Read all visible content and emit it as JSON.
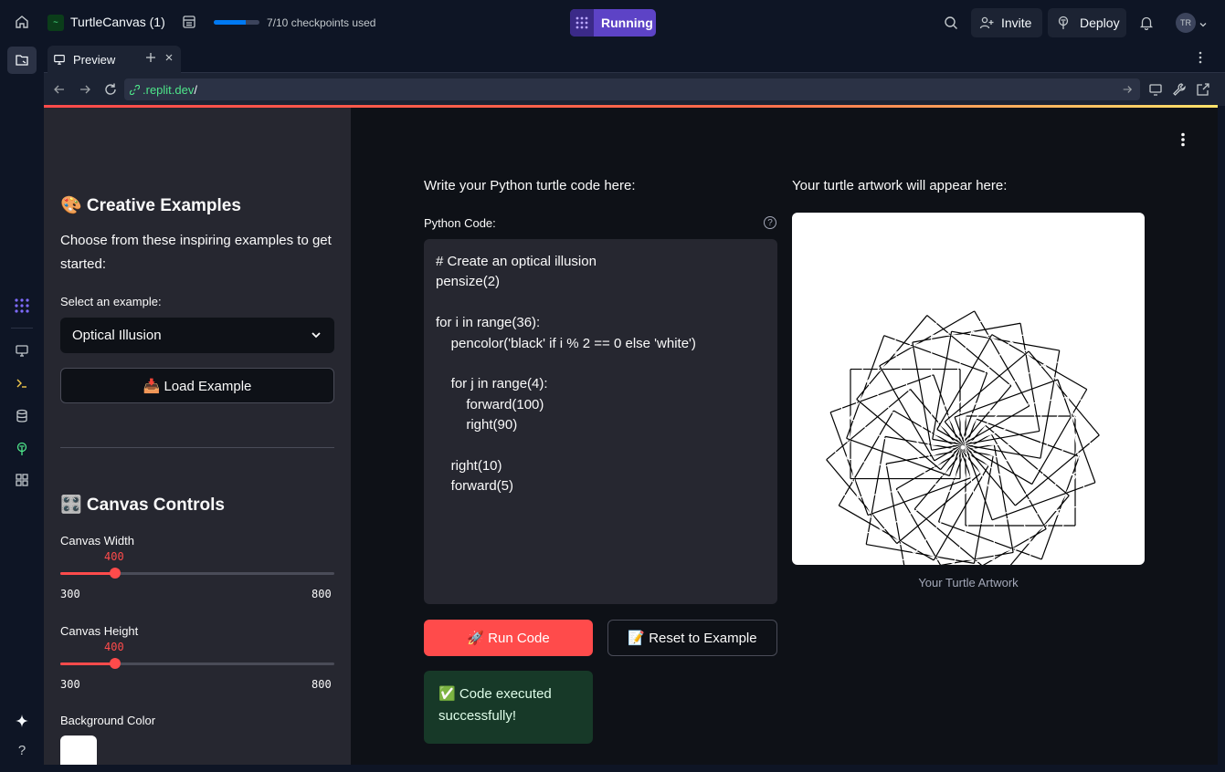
{
  "topbar": {
    "repl_name": "TurtleCanvas (1)",
    "checkpoints": "7/10 checkpoints used",
    "checkpoint_progress": 0.7,
    "run_status": "Running",
    "invite_label": "Invite",
    "deploy_label": "Deploy",
    "avatar_initials": "TR"
  },
  "tabs": [
    {
      "label": "Preview"
    }
  ],
  "urlbar": {
    "domain": ".replit.dev",
    "path": "/"
  },
  "sidebar": {
    "examples_header": "🎨 Creative Examples",
    "examples_desc": "Choose from these inspiring examples to get started:",
    "select_label": "Select an example:",
    "selected_example": "Optical Illusion",
    "load_button": "📥 Load Example",
    "canvas_header": "🎛️ Canvas Controls",
    "width": {
      "label": "Canvas Width",
      "value": 400,
      "min": 300,
      "max": 800,
      "value_text": "400",
      "min_text": "300",
      "max_text": "800"
    },
    "height": {
      "label": "Canvas Height",
      "value": 400,
      "min": 300,
      "max": 800,
      "value_text": "400",
      "min_text": "300",
      "max_text": "800"
    },
    "bg_label": "Background Color",
    "bg_color": "#ffffff"
  },
  "main": {
    "code_heading": "Write your Python turtle code here:",
    "code_label": "Python Code:",
    "code": "# Create an optical illusion\npensize(2)\n\nfor i in range(36):\n    pencolor('black' if i % 2 == 0 else 'white')\n\n    for j in range(4):\n        forward(100)\n        right(90)\n\n    right(10)\n    forward(5)",
    "run_button": "🚀 Run Code",
    "reset_button": "📝 Reset to Example",
    "success_msg": "✅ Code executed successfully!",
    "art_heading": "Your turtle artwork will appear here:",
    "art_caption": "Your Turtle Artwork"
  },
  "colors": {
    "accent": "#ff4b4b",
    "running": "#6b4fd8",
    "success_bg": "#173928"
  }
}
